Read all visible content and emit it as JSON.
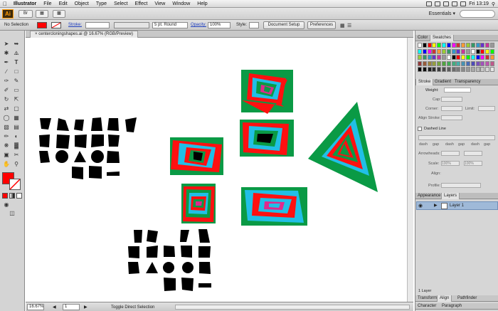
{
  "menubar": {
    "app": "Illustrator",
    "items": [
      "File",
      "Edit",
      "Object",
      "Type",
      "Select",
      "Effect",
      "View",
      "Window",
      "Help"
    ],
    "clock": "Fri 13:19"
  },
  "appbar": {
    "logo": "Ai",
    "workspace": "Essentials ▾"
  },
  "control": {
    "selection": "No Selection",
    "fill_color": "#ff0000",
    "stroke_label": "Stroke:",
    "brush": "5 pt. Round",
    "opacity_label": "Opacity:",
    "opacity_value": "100%",
    "style_label": "Style:",
    "document_setup": "Document Setup",
    "preferences": "Preferences"
  },
  "document": {
    "tab": "centercloningshapes.ai @ 16.67% (RGB/Preview)"
  },
  "status": {
    "zoom": "16.67%",
    "page": "1",
    "tool_hint": "Toggle Direct Selection"
  },
  "panels": {
    "color_tabs": [
      "Color",
      "Swatches"
    ],
    "stroke_tabs": [
      "Stroke",
      "Gradient",
      "Transparency"
    ],
    "weight_label": "Weight:",
    "cap_label": "Cap:",
    "corner_label": "Corner:",
    "limit_label": "Limit:",
    "align_label": "Align Stroke:",
    "dashed_label": "Dashed Line",
    "dash_labels": [
      "dash",
      "gap",
      "dash",
      "gap",
      "dash",
      "gap"
    ],
    "arrowheads_label": "Arrowheads:",
    "scale_label": "Scale:",
    "scale_values": [
      "100%",
      "100%"
    ],
    "align_arrow_label": "Align:",
    "profile_label": "Profile:",
    "layers_tabs": [
      "Appearance",
      "Layers"
    ],
    "layer_name": "Layer 1",
    "layers_count": "1 Layer",
    "bottom_tabs": [
      "Transform",
      "Align",
      "Pathfinder"
    ],
    "bottom_tabs2": [
      "Character",
      "Paragraph"
    ]
  },
  "colors": {
    "green": "#0a9a45",
    "red": "#ff1010",
    "cyan": "#21bfe6",
    "magenta": "#e0298c",
    "black": "#000000"
  }
}
